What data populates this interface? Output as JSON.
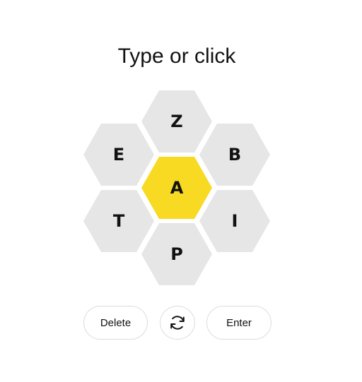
{
  "prompt": "Type or click",
  "colors": {
    "center": "#f7da21",
    "outer": "#e6e6e6",
    "text": "#121212"
  },
  "letters": {
    "center": "A",
    "top": "Z",
    "upper_left": "E",
    "upper_right": "B",
    "lower_left": "T",
    "lower_right": "I",
    "bottom": "P"
  },
  "controls": {
    "delete_label": "Delete",
    "shuffle_icon": "shuffle-icon",
    "enter_label": "Enter"
  }
}
